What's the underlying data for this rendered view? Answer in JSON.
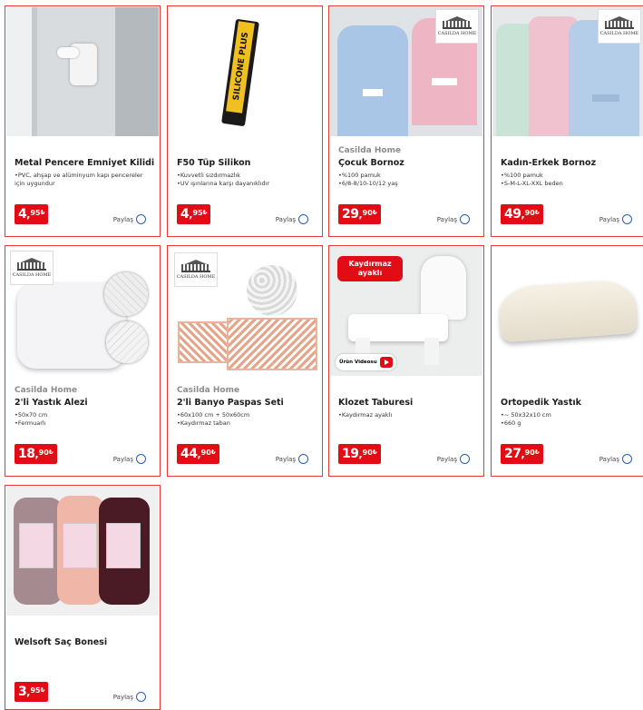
{
  "share_label": "Paylaş",
  "products": [
    {
      "brand": "",
      "title": "Metal Pencere Emniyet Kilidi",
      "bullets": [
        "PVC, ahşap ve alüminyum kapı pencereler için uygundur"
      ],
      "price_int": "4",
      "price_dec": "95",
      "currency": "₺"
    },
    {
      "brand": "",
      "title": "F50 Tüp Silikon",
      "bullets": [
        "Kuvvetli sızdırmazlık",
        "UV ışınlarına karşı dayanıklıdır"
      ],
      "price_int": "4",
      "price_dec": "95",
      "currency": "₺",
      "image_text": "SILICONE PLUS"
    },
    {
      "brand": "Casilda Home",
      "title": "Çocuk Bornoz",
      "bullets": [
        "%100 pamuk",
        "6/8-8/10-10/12 yaş"
      ],
      "price_int": "29",
      "price_dec": "90",
      "currency": "₺",
      "logo_text": "CASILDA HOME"
    },
    {
      "brand": "",
      "title": "Kadın-Erkek Bornoz",
      "bullets": [
        "%100 pamuk",
        "S-M-L-XL-XXL beden"
      ],
      "price_int": "49",
      "price_dec": "90",
      "currency": "₺",
      "logo_text": "CASILDA HOME"
    },
    {
      "brand": "Casilda Home",
      "title": "2'li Yastık Alezi",
      "bullets": [
        "50x70 cm",
        "Fermuarlı"
      ],
      "price_int": "18",
      "price_dec": "90",
      "currency": "₺",
      "logo_text": "CASILDA HOME"
    },
    {
      "brand": "Casilda Home",
      "title": "2'li Banyo Paspas Seti",
      "bullets": [
        "60x100 cm + 50x60cm",
        "Kaydırmaz taban"
      ],
      "price_int": "44",
      "price_dec": "90",
      "currency": "₺",
      "logo_text": "CASILDA HOME"
    },
    {
      "brand": "",
      "title": "Klozet Taburesi",
      "bullets": [
        "Kaydırmaz ayaklı"
      ],
      "price_int": "19",
      "price_dec": "90",
      "currency": "₺",
      "badge_text": "Kaydırmaz ayaklı",
      "video_label": "Ürün Videosu"
    },
    {
      "brand": "",
      "title": "Ortopedik Yastık",
      "bullets": [
        "~ 50x32x10 cm",
        "660 g"
      ],
      "price_int": "27",
      "price_dec": "90",
      "currency": "₺"
    },
    {
      "brand": "",
      "title": "Welsoft Saç Bonesi",
      "bullets": [],
      "price_int": "3",
      "price_dec": "95",
      "currency": "₺"
    }
  ]
}
